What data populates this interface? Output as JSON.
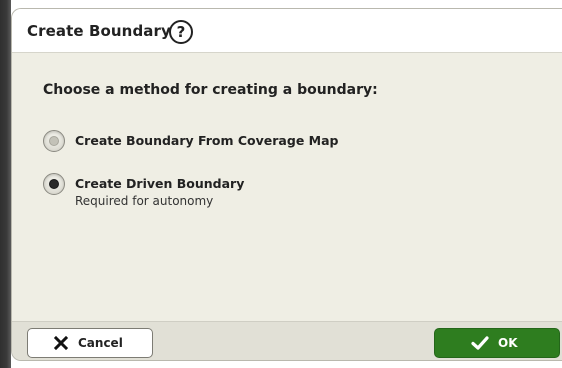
{
  "dialog": {
    "title": "Create Boundary",
    "help_icon": "help-icon",
    "help_glyph": "?",
    "prompt": "Choose a method for creating a boundary:",
    "options": [
      {
        "label": "Create Boundary From Coverage Map",
        "sublabel": "",
        "selected": false
      },
      {
        "label": "Create Driven Boundary",
        "sublabel": "Required for autonomy",
        "selected": true
      }
    ]
  },
  "footer": {
    "cancel_label": "Cancel",
    "cancel_icon": "close-icon",
    "ok_label": "OK",
    "ok_icon": "checkmark-icon"
  },
  "colors": {
    "dialog_bg": "#efeee4",
    "ok_green": "#2e7d1f",
    "text": "#222222"
  }
}
